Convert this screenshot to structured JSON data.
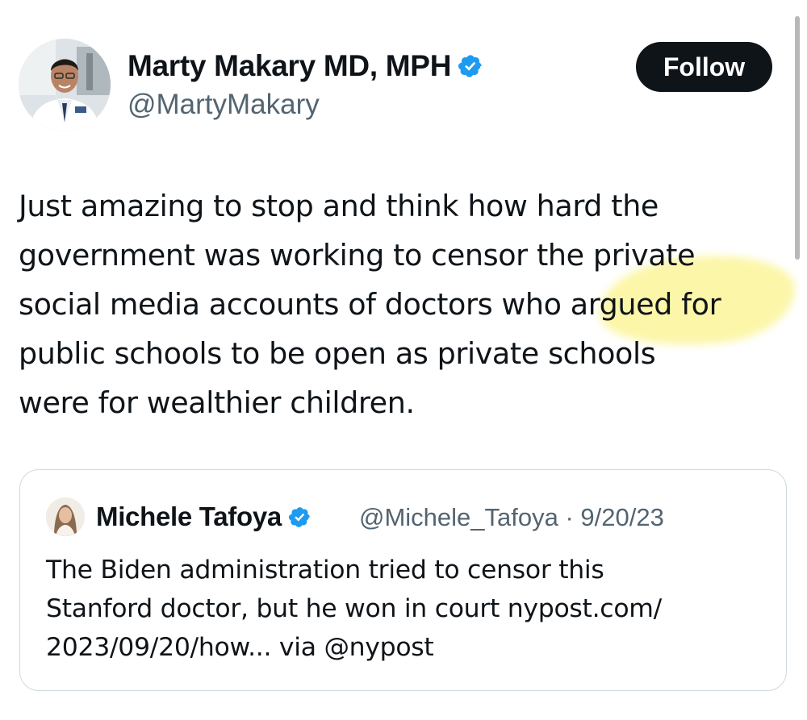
{
  "author": {
    "name": "Marty Makary MD, MPH",
    "handle": "@MartyMakary",
    "verified_color": "#1d9bf0"
  },
  "follow_button": {
    "label": "Follow"
  },
  "tweet": {
    "text_lines": [
      "Just amazing to stop and think how hard the",
      "government was working to censor the private",
      "social media accounts of doctors who argued for",
      "public schools to be open as private schools",
      "were for wealthier children."
    ],
    "highlight_color": "#fbf59a"
  },
  "quoted_tweet": {
    "name": "Michele Tafoya",
    "handle_date": "@Michele_Tafoya · 9/20/23",
    "text_lines": [
      "The Biden administration tried to censor this",
      "Stanford doctor, but he won in court nypost.com/",
      "2023/09/20/how... via @nypost"
    ]
  }
}
